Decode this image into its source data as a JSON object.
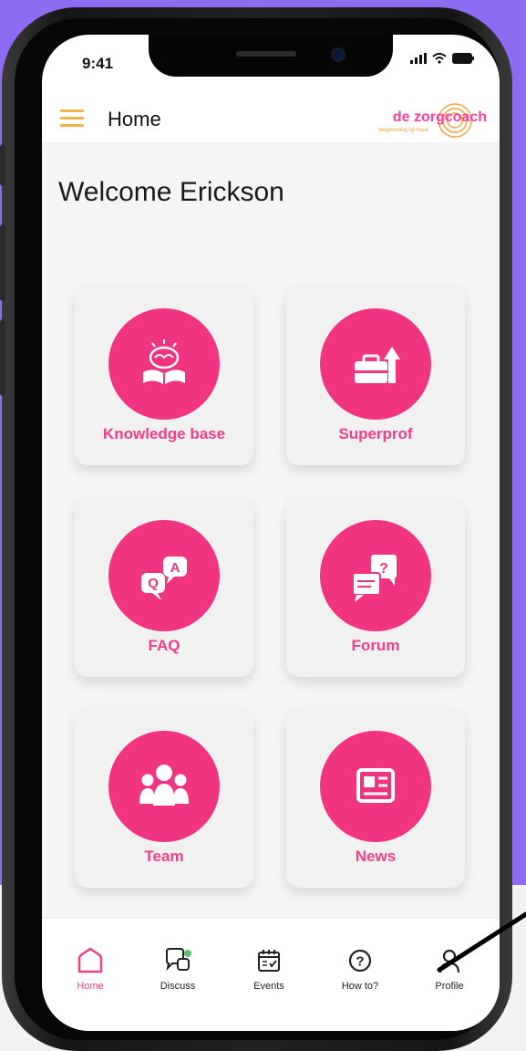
{
  "status_bar": {
    "time": "9:41"
  },
  "header": {
    "title": "Home",
    "logo_text": "de zorgcoach",
    "logo_tagline": "begeleiding op maat"
  },
  "welcome": "Welcome Erickson",
  "tiles": [
    {
      "label": "Knowledge base",
      "icon": "book-brain-icon"
    },
    {
      "label": "Superprof",
      "icon": "briefcase-growth-icon"
    },
    {
      "label": "FAQ",
      "icon": "qa-bubbles-icon"
    },
    {
      "label": "Forum",
      "icon": "chat-bubbles-icon"
    },
    {
      "label": "Team",
      "icon": "people-icon"
    },
    {
      "label": "News",
      "icon": "newspaper-icon"
    }
  ],
  "tabbar": [
    {
      "label": "Home",
      "icon": "home-icon",
      "active": true
    },
    {
      "label": "Discuss",
      "icon": "discuss-icon",
      "active": false
    },
    {
      "label": "Events",
      "icon": "calendar-icon",
      "active": false
    },
    {
      "label": "How to?",
      "icon": "help-circle-icon",
      "active": false
    },
    {
      "label": "Profile",
      "icon": "profile-icon",
      "active": false
    }
  ],
  "colors": {
    "accent": "#f0347f",
    "accent_text": "#ef3f87",
    "menu": "#f1b24a",
    "logo_ring": "#f1a63d",
    "background": "#8d6cf2"
  }
}
